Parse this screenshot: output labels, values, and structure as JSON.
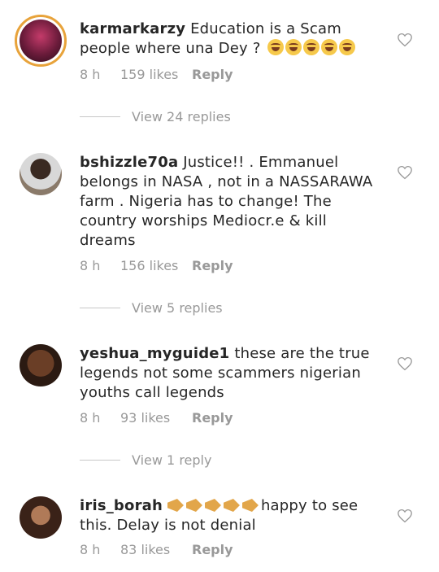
{
  "comments": [
    {
      "username": "karmarkarzy",
      "text": "Education is a Scam people where una Dey ?",
      "emojis": [
        "grinning-sweat-emoji",
        "grinning-sweat-emoji",
        "grinning-sweat-emoji",
        "grinning-sweat-emoji",
        "grinning-sweat-emoji"
      ],
      "time": "8 h",
      "likes": "159 likes",
      "reply": "Reply",
      "view_replies": "View 24 replies"
    },
    {
      "username": "bshizzle70a",
      "text": "Justice!! . Emmanuel belongs in NASA , not in a NASSARAWA farm . Nigeria has to change! The country worships Mediocr.e & kill dreams",
      "time": "8 h",
      "likes": "156 likes",
      "reply": "Reply",
      "view_replies": "View 5 replies"
    },
    {
      "username": "yeshua_myguide1",
      "text": "these are the true legends not some scammers nigerian youths call legends",
      "time": "8 h",
      "likes": "93 likes",
      "reply": "Reply",
      "view_replies": "View 1 reply"
    },
    {
      "username": "iris_borah",
      "emojis": [
        "hand-pointing-right-emoji",
        "hand-pointing-right-emoji",
        "hand-pointing-right-emoji",
        "hand-pointing-right-emoji",
        "hand-pointing-right-emoji"
      ],
      "text": "happy to see this. Delay is not denial",
      "time": "8 h",
      "likes": "83 likes",
      "reply": "Reply"
    }
  ],
  "icons": {
    "like": "heart-outline-icon"
  },
  "colors": {
    "meta": "#999999",
    "text": "#262626",
    "avatar_ring": "#e8a33b"
  }
}
